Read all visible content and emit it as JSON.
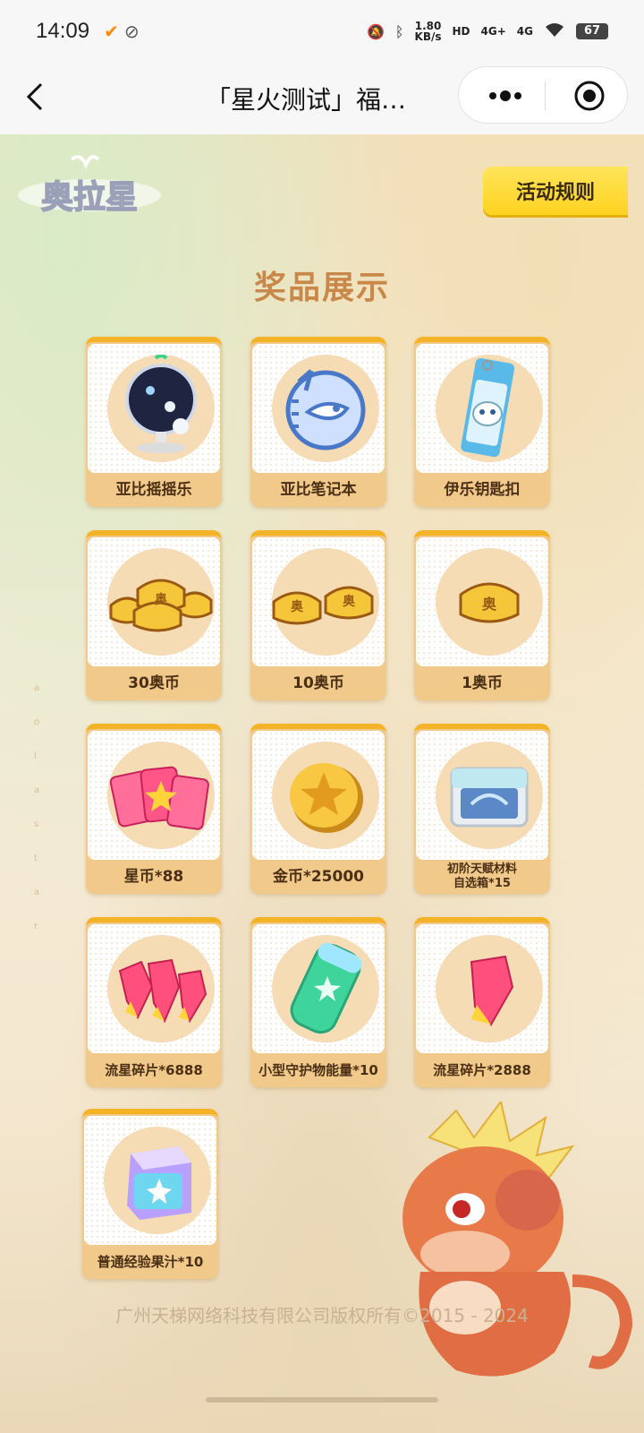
{
  "status_bar": {
    "time": "14:09",
    "speed_value": "1.80",
    "speed_unit": "KB/s",
    "hd_label": "HD",
    "signal_1": "4G+",
    "signal_2": "4G",
    "battery": "67"
  },
  "nav": {
    "title": "「星火测试」福…"
  },
  "page": {
    "rules_button": "活动规则",
    "section_title": "奖品展示",
    "footer": "广州天梯网络科技有限公司版权所有©2015 - 2024"
  },
  "prizes": [
    {
      "label": "亚比摇摇乐",
      "icon": "snow-globe-icon"
    },
    {
      "label": "亚比笔记本",
      "icon": "notebook-icon"
    },
    {
      "label": "伊乐钥匙扣",
      "icon": "keychain-icon"
    },
    {
      "label": "30奥币",
      "icon": "coin-stack-icon"
    },
    {
      "label": "10奥币",
      "icon": "coin-pair-icon"
    },
    {
      "label": "1奥币",
      "icon": "coin-icon"
    },
    {
      "label": "星币*88",
      "icon": "star-card-icon"
    },
    {
      "label": "金币*25000",
      "icon": "gold-coin-icon"
    },
    {
      "label": "初阶天赋材料\n自选箱*15",
      "icon": "chest-icon"
    },
    {
      "label": "流星碎片*6888",
      "icon": "crystal-shards-icon"
    },
    {
      "label": "小型守护物能量*10",
      "icon": "battery-icon"
    },
    {
      "label": "流星碎片*2888",
      "icon": "crystal-shard-icon"
    },
    {
      "label": "普通经验果汁*10",
      "icon": "juice-box-icon"
    }
  ],
  "colors": {
    "accent": "#ffd21f",
    "card_top": "#f4b226",
    "card_bg": "#f1c98b",
    "title": "#c9884a"
  }
}
